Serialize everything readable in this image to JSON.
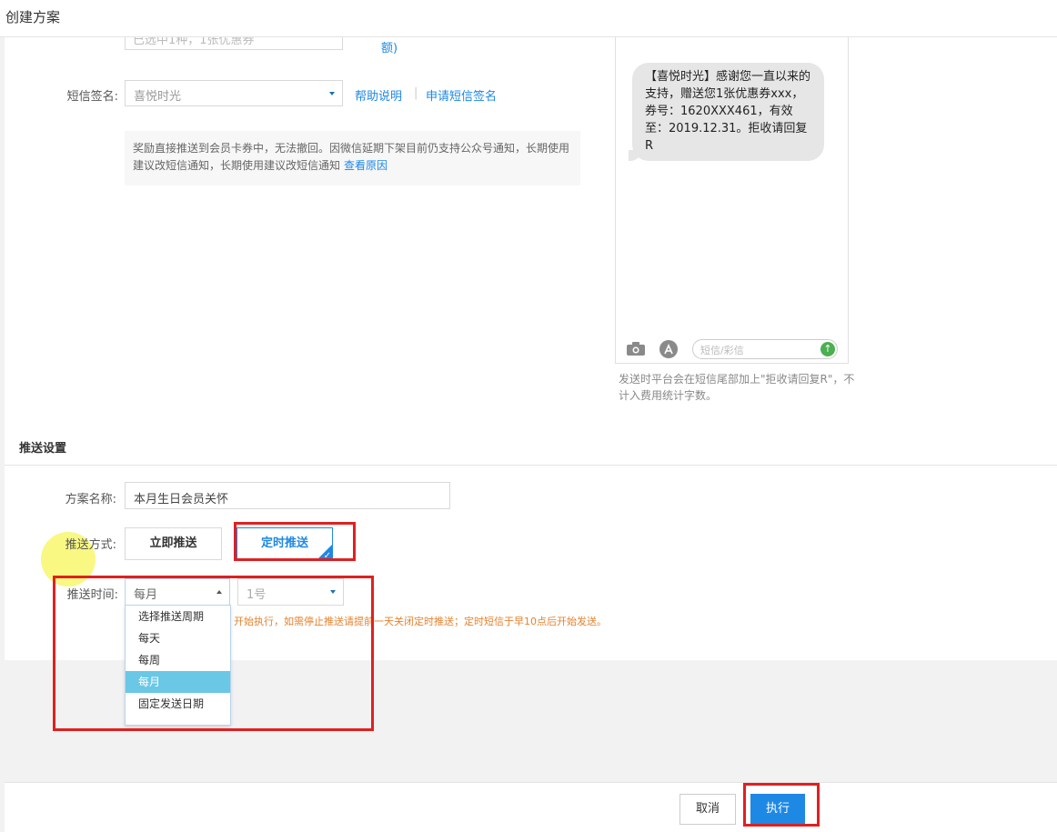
{
  "header": {
    "title": "创建方案"
  },
  "top_partial": {
    "input_text": "已选中1种，1张优惠券",
    "link_text": "额)"
  },
  "sms_signature": {
    "label": "短信签名:",
    "selected": "喜悦时光",
    "help_link": "帮助说明",
    "separator": "|",
    "apply_link": "申请短信签名"
  },
  "notice": {
    "text": "奖励直接推送到会员卡券中，无法撤回。因微信延期下架目前仍支持公众号通知，长期使用建议改短信通知，长期使用建议改短信通知",
    "link": "查看原因"
  },
  "preview": {
    "message": "【喜悦时光】感谢您一直以来的支持，赠送您1张优惠券xxx，券号：1620XXX461，有效至：2019.12.31。拒收请回复R",
    "input_placeholder": "短信/彩信",
    "send_icon": "↑",
    "note": "发送时平台会在短信尾部加上\"拒收请回复R\"，不计入费用统计字数。"
  },
  "push_settings": {
    "section_title": "推送设置",
    "plan_name_label": "方案名称:",
    "plan_name_value": "本月生日会员关怀",
    "method_label": "推送方式:",
    "method_immediate": "立即推送",
    "method_scheduled": "定时推送",
    "check_mark": "✓",
    "time_label": "推送时间:",
    "period_selected": "每月",
    "day_selected": "1号",
    "period_options": [
      "选择推送周期",
      "每天",
      "每周",
      "每月",
      "固定发送日期"
    ],
    "period_options_selected_index": 3,
    "warning": "开始执行，如需停止推送请提前一天关闭定时推送；定时短信于早10点后开始发送。"
  },
  "footer": {
    "cancel_label": "取消",
    "execute_label": "执行"
  },
  "colors": {
    "accent": "#1e88e5",
    "highlight_box": "#e02020",
    "warning": "#e6822e",
    "option_selected": "#6ac7e6"
  },
  "icons": [
    "caret-down-icon",
    "camera-icon",
    "app-store-icon",
    "send-arrow-icon",
    "checkmark-icon"
  ]
}
